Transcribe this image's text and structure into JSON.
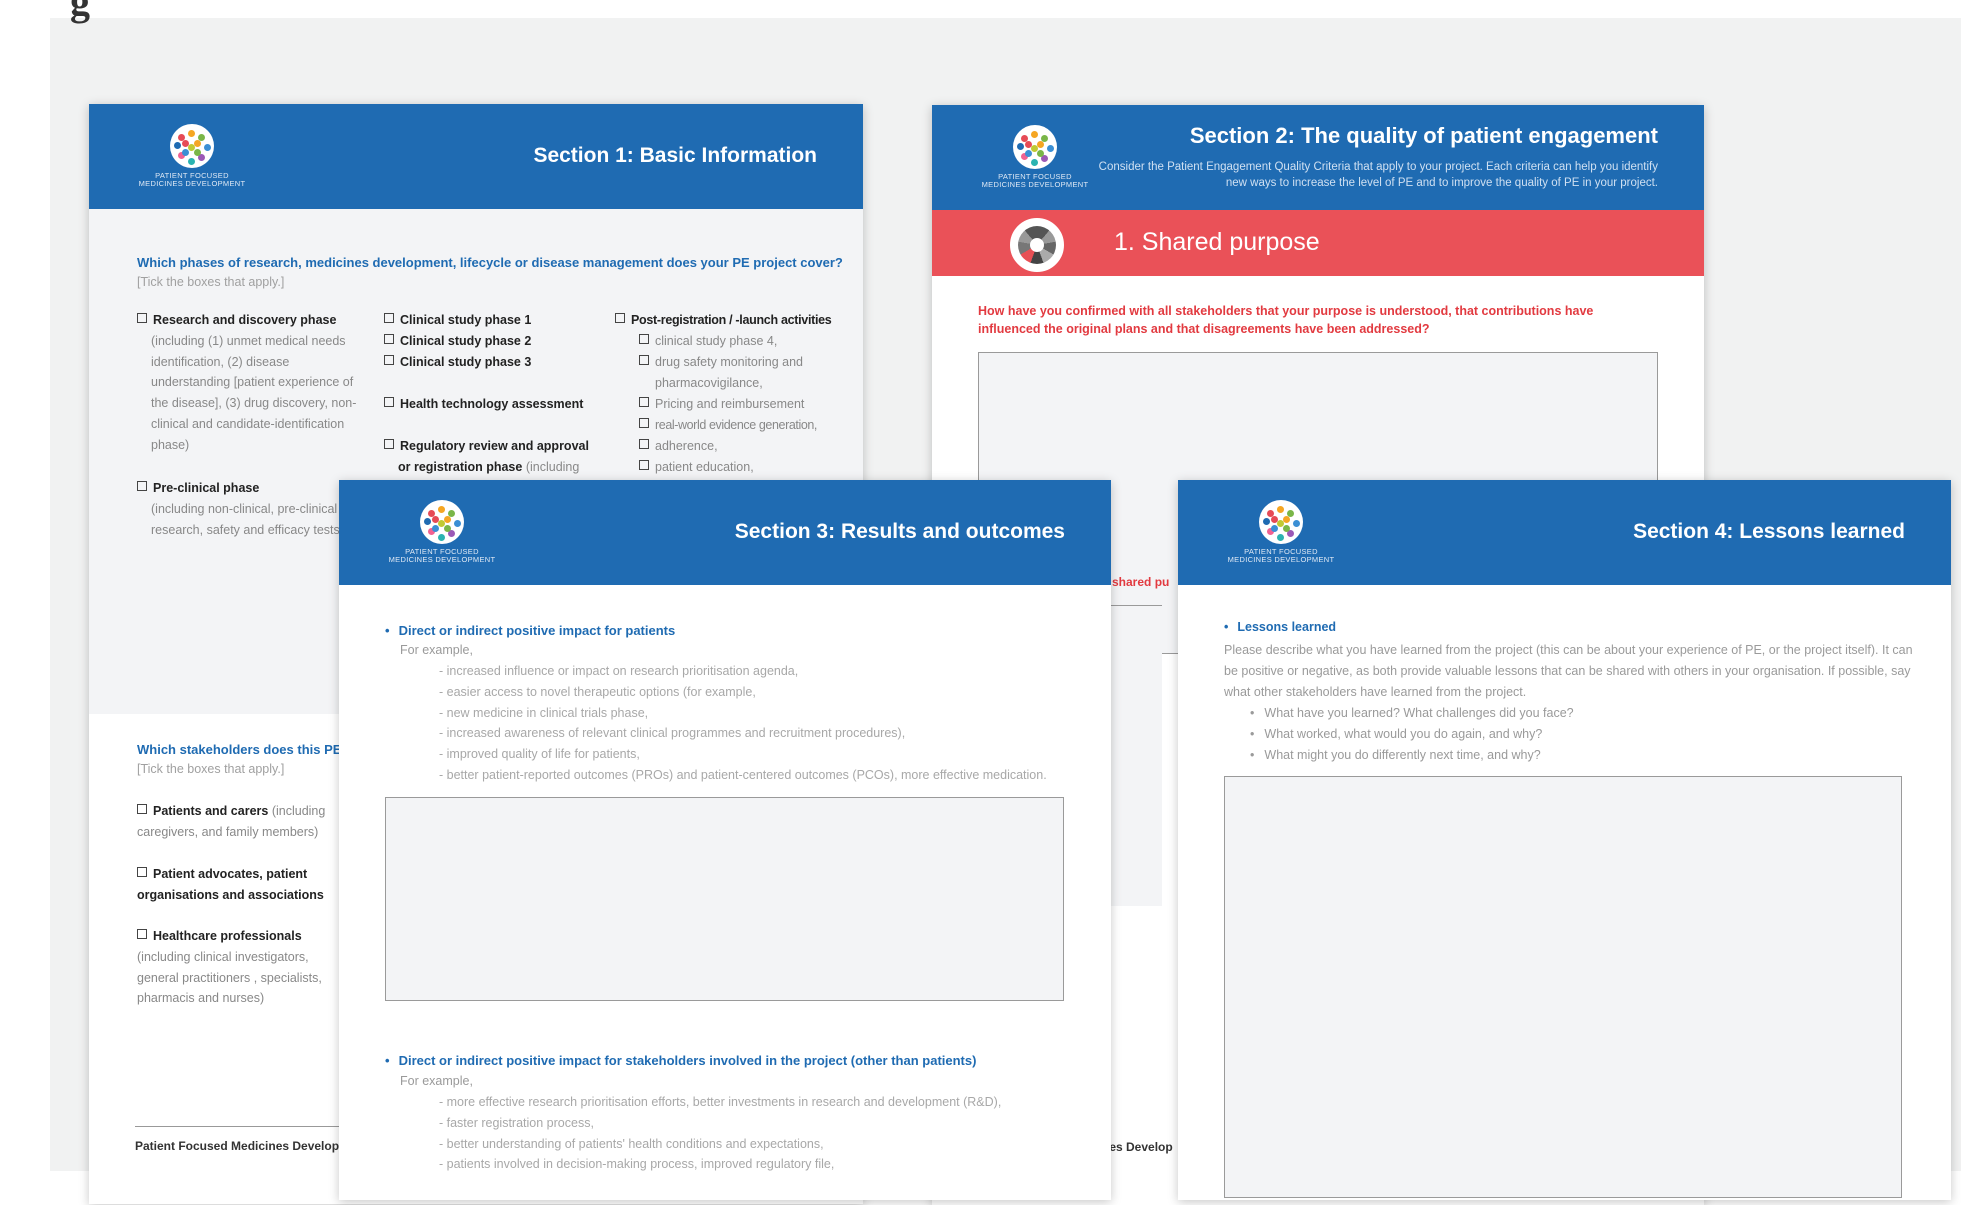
{
  "logo": {
    "line1": "PATIENT FOCUSED",
    "line2": "MEDICINES DEVELOPMENT",
    "dot_colors": [
      "#e64b56",
      "#f5a623",
      "#7ab648",
      "#3b8fd4",
      "#9b59b6",
      "#2ab3b1",
      "#f06292",
      "#1f6bb2",
      "#c0ca33"
    ]
  },
  "colors": {
    "header_blue": "#1f6bb2",
    "banner_red": "#ea5158",
    "question_red": "#e23a40"
  },
  "section1": {
    "title": "Section 1: Basic Information",
    "question1": "Which phases of research, medicines development, lifecycle or disease management does your PE project cover?",
    "hint1": "[Tick the boxes that apply.]",
    "col1": [
      {
        "label": "Research and discovery phase",
        "detail": "(including (1) unmet medical needs identification, (2) disease understanding [patient experience of the disease], (3) drug discovery, non-clinical and candidate-identification phase)"
      },
      {
        "label": "Pre-clinical phase",
        "detail": "(including non-clinical, pre-clinical research, safety and efficacy tests)"
      }
    ],
    "col2": {
      "phase1": "Clinical study phase 1",
      "phase2": "Clinical study phase 2",
      "phase3": "Clinical study phase 3",
      "hta": "Health technology assessment",
      "regulatory": "Regulatory review and approval",
      "regulatory2": "or registration phase",
      "regulatory2_detail": "(including"
    },
    "col3": {
      "title": "Post-registration / -launch activities",
      "items": [
        "clinical study phase 4,",
        "drug safety monitoring and pharmacovigilance,",
        "Pricing and reimbursement",
        "real-world evidence generation,",
        "adherence,",
        "patient education,"
      ]
    },
    "question2": "Which stakeholders does this PE p",
    "hint2": "[Tick the boxes that apply.]",
    "stakeholders": [
      {
        "label": "Patients and carers",
        "detail": "(including caregivers, and family members)"
      },
      {
        "label": "Patient advocates, patient organisations and associations",
        "detail": ""
      },
      {
        "label": "Healthcare professionals",
        "detail": "(including clinical investigators, general practitioners , specialists, pharmacis and nurses)"
      }
    ],
    "footer": "Patient Focused Medicines Developm"
  },
  "section2": {
    "title": "Section 2: The quality of patient engagement",
    "subtitle": "Consider the Patient Engagement Quality Criteria that apply to your project. Each criteria can help you identify new ways to increase the level of PE and to improve the quality of PE in your project.",
    "banner_label": "1. Shared purpose",
    "question": "How have you confirmed with all stakeholders that your purpose is understood, that contributions have influenced the original plans and that disagreements have been addressed?",
    "fragment": "e shared pu",
    "footer_fragment": "nes Develop"
  },
  "section3": {
    "title": "Section 3: Results and outcomes",
    "bullet1": "Direct or indirect positive impact for patients",
    "example_label": "For example,",
    "examples1": [
      "- increased influence or impact on research prioritisation agenda,",
      "- easier access to novel therapeutic options (for example,",
      "- new medicine in clinical trials phase,",
      "- increased awareness of relevant clinical programmes and recruitment procedures),",
      "- improved quality of life for patients,",
      "- better patient-reported outcomes (PROs) and patient-centered outcomes (PCOs), more effective medication."
    ],
    "bullet2": "Direct or indirect positive impact for stakeholders involved in the project (other than patients)",
    "examples2": [
      "- more effective research prioritisation efforts, better investments in research and development (R&D),",
      "- faster registration process,",
      "- better understanding of patients' health conditions and expectations,",
      "- patients involved in decision-making process, improved regulatory file,"
    ]
  },
  "section4": {
    "title": "Section 4: Lessons learned",
    "heading": "Lessons learned",
    "intro": "Please describe what you have learned from the project (this can be about your experience of PE, or the project itself). It can be positive or negative, as both provide valuable lessons that can be shared with others in your organisation. If possible, say what other stakeholders have learned from the project.",
    "bullets": [
      "What have you learned? What challenges did you face?",
      "What worked, what would you do again, and why?",
      "What might you do differently next time, and why?"
    ]
  },
  "top_fragment": "g"
}
